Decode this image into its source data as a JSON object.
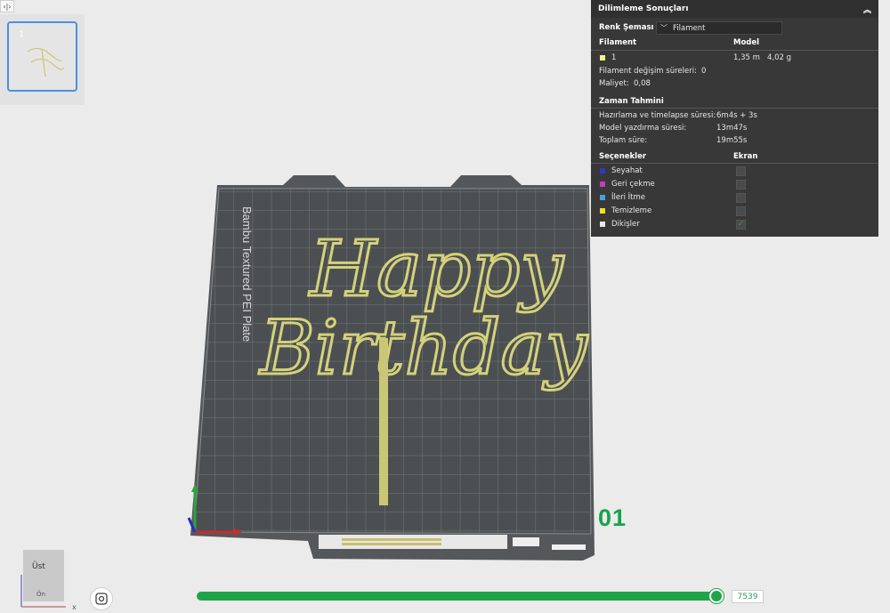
{
  "left_toggle": {
    "icon": "collapse-arrows-icon",
    "symbol": "‹|›"
  },
  "thumbnail": {
    "plate_number": "1"
  },
  "bed": {
    "label": "Bambu Textured PEI Plate",
    "model_text_line1": "Happy",
    "model_text_line2": "Birthday",
    "filament_color": "#d4d27a"
  },
  "layer": {
    "number": "01"
  },
  "slider": {
    "value": "7539",
    "fill_fraction": 0.99
  },
  "viewcube": {
    "face_label": "Üst",
    "front_label": "Ön",
    "x_axis": "x"
  },
  "panel": {
    "title": "Dilimleme Sonuçları",
    "color_scheme_label": "Renk Şeması",
    "color_scheme_value": "Filament",
    "filament_header": "Filament",
    "model_header": "Model",
    "filament_rows": [
      {
        "id": "1",
        "color": "#f3f38a",
        "length": "1,35 m",
        "weight": "4,02 g"
      }
    ],
    "change_times_label": "Filament değişim süreleri:",
    "change_times_value": "0",
    "cost_label": "Maliyet:",
    "cost_value": "0,08",
    "time_section": "Zaman Tahmini",
    "prep_label": "Hazırlama ve timelapse süresi:",
    "prep_value": "6m4s + 3s",
    "model_print_label": "Model yazdırma süresi:",
    "model_print_value": "13m47s",
    "total_label": "Toplam süre:",
    "total_value": "19m55s",
    "options_header": "Seçenekler",
    "display_header": "Ekran",
    "options": [
      {
        "label": "Seyahat",
        "color": "#3535c8",
        "checked": false
      },
      {
        "label": "Geri çekme",
        "color": "#c43cc4",
        "checked": false
      },
      {
        "label": "İleri İtme",
        "color": "#3fa5d8",
        "checked": false
      },
      {
        "label": "Temizleme",
        "color": "#f0e020",
        "checked": false
      },
      {
        "label": "Dikişler",
        "color": "#e8e8e8",
        "checked": true
      }
    ]
  }
}
